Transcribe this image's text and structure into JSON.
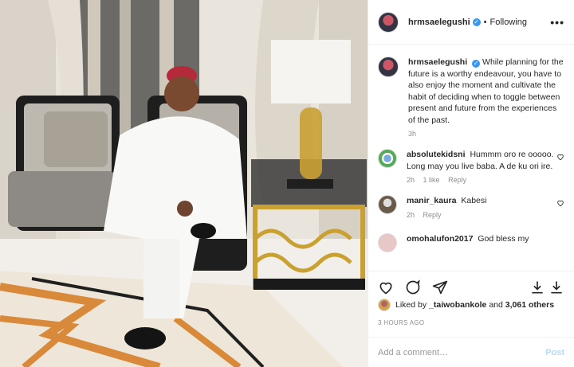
{
  "post": {
    "author": "hrmsaelegushi",
    "verified_icon": "verified-badge-icon",
    "follow_label": "Following",
    "more_label": "•••"
  },
  "comments": [
    {
      "user": "hrmsaelegushi",
      "text": "While planning for the future is a worthy endeavour, you have to also enjoy the moment and cultivate the habit of deciding when to toggle between present and future from the experiences of the past.",
      "time": "3h",
      "likes": "",
      "reply": ""
    },
    {
      "user": "absolutekidsni",
      "text": "Hummm oro re ooooo. Long may you live baba. A de ku ori ire.",
      "time": "2h",
      "likes": "1 like",
      "reply": "Reply"
    },
    {
      "user": "manir_kaura",
      "text": "Kabesi",
      "time": "2h",
      "likes": "",
      "reply": "Reply"
    },
    {
      "user": "omohalufon2017",
      "text": "God bless my",
      "time": "",
      "likes": "",
      "reply": ""
    }
  ],
  "likes": {
    "prefix": "Liked by",
    "user": "_taiwobankole",
    "mid": "and",
    "count": "3,061 others"
  },
  "timestamp": "3 HOURS AGO",
  "add_comment": {
    "placeholder": "Add a comment…",
    "post_label": "Post"
  },
  "colors": {
    "verified": "#3897f0",
    "muted": "#8e8e8e",
    "post_disabled": "#b3dbff"
  }
}
